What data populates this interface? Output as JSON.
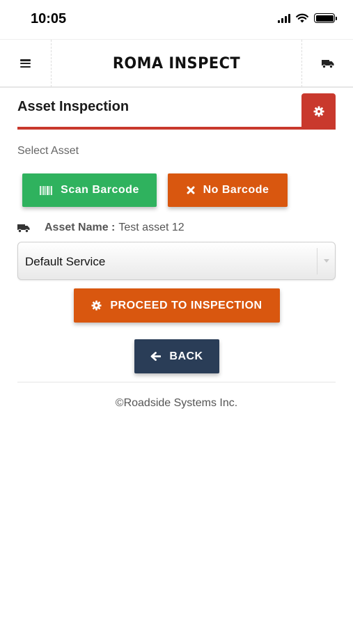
{
  "status_bar": {
    "time": "10:05",
    "icons": [
      "signal-icon",
      "wifi-icon",
      "battery-icon"
    ]
  },
  "header": {
    "logo_text": "ROMA INSPECT",
    "menu_icon": "hamburger-icon",
    "right_icon": "truck-icon"
  },
  "page": {
    "title": "Asset Inspection",
    "settings_icon": "gear-icon",
    "select_label": "Select Asset"
  },
  "buttons": {
    "scan_barcode": "Scan Barcode",
    "no_barcode": "No Barcode",
    "proceed": "PROCEED TO INSPECTION",
    "back": "BACK"
  },
  "asset": {
    "label": "Asset Name :",
    "value": "Test asset 12"
  },
  "service_select": {
    "selected": "Default Service"
  },
  "footer": {
    "copyright": "©Roadside Systems Inc."
  },
  "colors": {
    "accent_red": "#c9392d",
    "green": "#2fb25e",
    "orange": "#d9570f",
    "navy": "#2a3d57"
  }
}
